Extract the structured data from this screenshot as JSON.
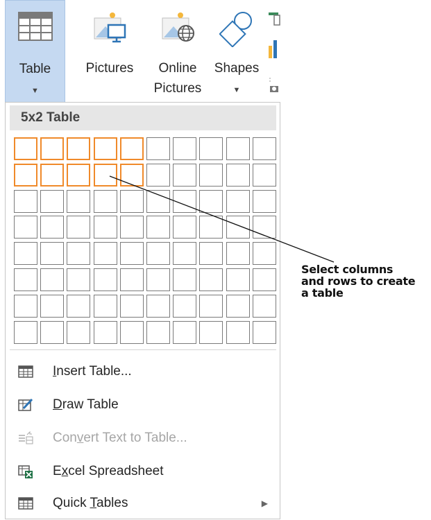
{
  "ribbon": {
    "table": {
      "label": "Table"
    },
    "pictures": {
      "label": "Pictures"
    },
    "online_pictures": {
      "label_line1": "Online",
      "label_line2": "Pictures"
    },
    "shapes": {
      "label": "Shapes"
    }
  },
  "dropdown": {
    "header": "5x2 Table",
    "grid": {
      "columns": 10,
      "rows": 8,
      "selected_columns": 5,
      "selected_rows": 2
    },
    "items": [
      {
        "pre": "",
        "accel": "I",
        "post": "nsert Table...",
        "icon": "table-icon",
        "enabled": true
      },
      {
        "pre": "",
        "accel": "D",
        "post": "raw Table",
        "icon": "draw-table-icon",
        "enabled": true
      },
      {
        "pre": "Con",
        "accel": "v",
        "post": "ert Text to Table...",
        "icon": "convert-text-icon",
        "enabled": false
      },
      {
        "pre": "E",
        "accel": "x",
        "post": "cel Spreadsheet",
        "icon": "excel-icon",
        "enabled": true
      },
      {
        "pre": "Quick ",
        "accel": "T",
        "post": "ables",
        "icon": "quick-tables-icon",
        "enabled": true
      }
    ]
  },
  "callout": {
    "line1": "Select columns",
    "line2": "and rows to create",
    "line3": "a table"
  },
  "colors": {
    "selection": "#f08a2a",
    "ribbon_active": "#c5d9f1"
  }
}
